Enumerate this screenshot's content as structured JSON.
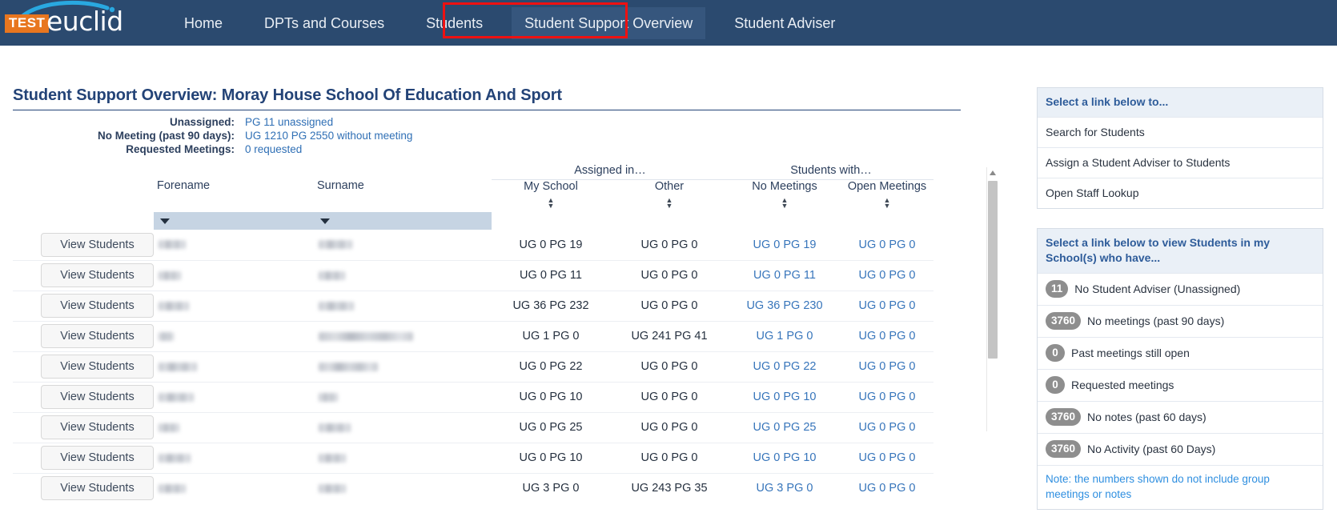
{
  "nav": {
    "logo": {
      "badge": "TEST",
      "word": "euclid",
      "icon": "swoosh-icon"
    },
    "items": [
      {
        "label": "Home",
        "active": false
      },
      {
        "label": "DPTs and Courses",
        "active": false
      },
      {
        "label": "Students",
        "active": false
      },
      {
        "label": "Student Support Overview",
        "active": true
      },
      {
        "label": "Student Adviser",
        "active": false
      }
    ],
    "highlight_color": "#ee1111"
  },
  "main": {
    "title": "Student Support Overview: Moray House School Of Education And Sport",
    "summary": [
      {
        "label": "Unassigned:",
        "value": "PG 11 unassigned"
      },
      {
        "label": "No Meeting (past 90 days):",
        "value": "UG 1210 PG 2550 without meeting"
      },
      {
        "label": "Requested Meetings:",
        "value": "0 requested"
      }
    ],
    "table": {
      "group_headers": [
        "Assigned in…",
        "Students with…"
      ],
      "columns": [
        "Forename",
        "Surname",
        "My School",
        "Other",
        "No Meetings",
        "Open Meetings"
      ],
      "row_button_label": "View Students",
      "filter_icon": "chevron-down-icon",
      "sort_icon": "sort-updown-icon",
      "rows": [
        {
          "forename": "",
          "surname": "",
          "my_school": "UG 0 PG 19",
          "other": "UG 0 PG 0",
          "no_meetings": "UG 0 PG 19",
          "open_meetings": "UG 0 PG 0"
        },
        {
          "forename": "",
          "surname": "",
          "my_school": "UG 0 PG 11",
          "other": "UG 0 PG 0",
          "no_meetings": "UG 0 PG 11",
          "open_meetings": "UG 0 PG 0"
        },
        {
          "forename": "",
          "surname": "",
          "my_school": "UG 36 PG 232",
          "other": "UG 0 PG 0",
          "no_meetings": "UG 36 PG 230",
          "open_meetings": "UG 0 PG 0"
        },
        {
          "forename": "",
          "surname": "",
          "my_school": "UG 1 PG 0",
          "other": "UG 241 PG 41",
          "no_meetings": "UG 1 PG 0",
          "open_meetings": "UG 0 PG 0"
        },
        {
          "forename": "",
          "surname": "",
          "my_school": "UG 0 PG 22",
          "other": "UG 0 PG 0",
          "no_meetings": "UG 0 PG 22",
          "open_meetings": "UG 0 PG 0"
        },
        {
          "forename": "",
          "surname": "",
          "my_school": "UG 0 PG 10",
          "other": "UG 0 PG 0",
          "no_meetings": "UG 0 PG 10",
          "open_meetings": "UG 0 PG 0"
        },
        {
          "forename": "",
          "surname": "",
          "my_school": "UG 0 PG 25",
          "other": "UG 0 PG 0",
          "no_meetings": "UG 0 PG 25",
          "open_meetings": "UG 0 PG 0"
        },
        {
          "forename": "",
          "surname": "",
          "my_school": "UG 0 PG 10",
          "other": "UG 0 PG 0",
          "no_meetings": "UG 0 PG 10",
          "open_meetings": "UG 0 PG 0"
        },
        {
          "forename": "",
          "surname": "",
          "my_school": "UG 3 PG 0",
          "other": "UG 243 PG 35",
          "no_meetings": "UG 3 PG 0",
          "open_meetings": "UG 0 PG 0"
        }
      ]
    }
  },
  "sidebar": {
    "panel1": {
      "heading": "Select a link below to...",
      "items": [
        {
          "label": "Search for Students"
        },
        {
          "label": "Assign a Student Adviser to Students"
        },
        {
          "label": "Open Staff Lookup"
        }
      ]
    },
    "panel2": {
      "heading": "Select a link below to view Students in my School(s) who have...",
      "items": [
        {
          "count": "11",
          "label": "No Student Adviser (Unassigned)"
        },
        {
          "count": "3760",
          "label": "No meetings (past 90 days)"
        },
        {
          "count": "0",
          "label": "Past meetings still open"
        },
        {
          "count": "0",
          "label": "Requested meetings"
        },
        {
          "count": "3760",
          "label": "No notes (past 60 days)"
        },
        {
          "count": "3760",
          "label": "No Activity (past 60 Days)"
        }
      ],
      "note": "Note: the numbers shown do not include group meetings or notes"
    }
  }
}
